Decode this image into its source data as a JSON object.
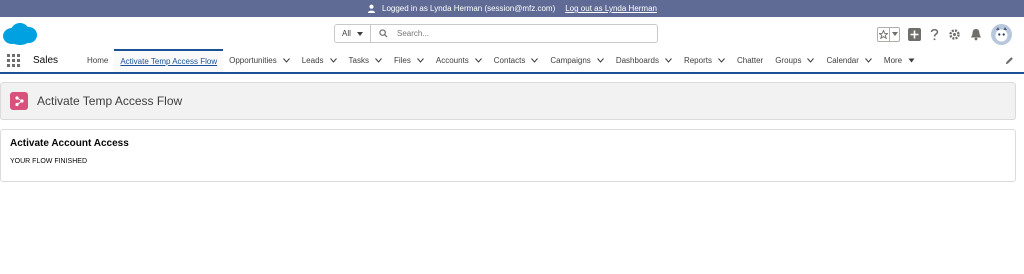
{
  "impersonation": {
    "logged_in_text": "Logged in as Lynda Herman (session@mfz.com)",
    "logout_label": "Log out as Lynda Herman"
  },
  "search": {
    "scope": "All",
    "placeholder": "Search..."
  },
  "nav": {
    "app_name": "Sales",
    "items": [
      {
        "label": "Home"
      },
      {
        "label": "Activate Temp Access Flow"
      },
      {
        "label": "Opportunities"
      },
      {
        "label": "Leads"
      },
      {
        "label": "Tasks"
      },
      {
        "label": "Files"
      },
      {
        "label": "Accounts"
      },
      {
        "label": "Contacts"
      },
      {
        "label": "Campaigns"
      },
      {
        "label": "Dashboards"
      },
      {
        "label": "Reports"
      },
      {
        "label": "Chatter"
      },
      {
        "label": "Groups"
      },
      {
        "label": "Calendar"
      },
      {
        "label": "More"
      }
    ]
  },
  "page": {
    "title": "Activate Temp Access Flow"
  },
  "card": {
    "title": "Activate Account Access",
    "message": "YOUR FLOW FINISHED"
  },
  "colors": {
    "impersonation_bar": "#5f6b94",
    "brand_blue": "#1b5297",
    "flow_icon": "#d9527d",
    "salesforce_logo": "#00a1e0"
  },
  "icons": [
    "user-icon",
    "salesforce-logo",
    "search-icon",
    "favorites-star-icon",
    "add-icon",
    "help-icon",
    "setup-gear-icon",
    "notification-bell-icon",
    "avatar",
    "app-launcher-icon",
    "edit-pencil-icon",
    "flow-icon"
  ]
}
